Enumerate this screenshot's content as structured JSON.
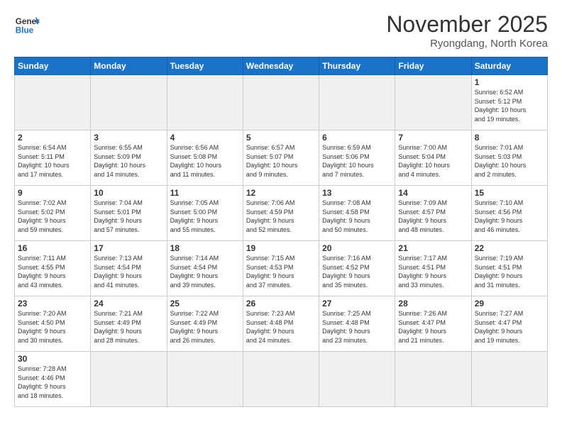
{
  "header": {
    "logo_general": "General",
    "logo_blue": "Blue",
    "month_title": "November 2025",
    "subtitle": "Ryongdang, North Korea"
  },
  "weekdays": [
    "Sunday",
    "Monday",
    "Tuesday",
    "Wednesday",
    "Thursday",
    "Friday",
    "Saturday"
  ],
  "weeks": [
    [
      {
        "day": "",
        "info": "",
        "empty": true
      },
      {
        "day": "",
        "info": "",
        "empty": true
      },
      {
        "day": "",
        "info": "",
        "empty": true
      },
      {
        "day": "",
        "info": "",
        "empty": true
      },
      {
        "day": "",
        "info": "",
        "empty": true
      },
      {
        "day": "",
        "info": "",
        "empty": true
      },
      {
        "day": "1",
        "info": "Sunrise: 6:52 AM\nSunset: 5:12 PM\nDaylight: 10 hours\nand 19 minutes."
      }
    ],
    [
      {
        "day": "2",
        "info": "Sunrise: 6:54 AM\nSunset: 5:11 PM\nDaylight: 10 hours\nand 17 minutes."
      },
      {
        "day": "3",
        "info": "Sunrise: 6:55 AM\nSunset: 5:09 PM\nDaylight: 10 hours\nand 14 minutes."
      },
      {
        "day": "4",
        "info": "Sunrise: 6:56 AM\nSunset: 5:08 PM\nDaylight: 10 hours\nand 11 minutes."
      },
      {
        "day": "5",
        "info": "Sunrise: 6:57 AM\nSunset: 5:07 PM\nDaylight: 10 hours\nand 9 minutes."
      },
      {
        "day": "6",
        "info": "Sunrise: 6:59 AM\nSunset: 5:06 PM\nDaylight: 10 hours\nand 7 minutes."
      },
      {
        "day": "7",
        "info": "Sunrise: 7:00 AM\nSunset: 5:04 PM\nDaylight: 10 hours\nand 4 minutes."
      },
      {
        "day": "8",
        "info": "Sunrise: 7:01 AM\nSunset: 5:03 PM\nDaylight: 10 hours\nand 2 minutes."
      }
    ],
    [
      {
        "day": "9",
        "info": "Sunrise: 7:02 AM\nSunset: 5:02 PM\nDaylight: 9 hours\nand 59 minutes."
      },
      {
        "day": "10",
        "info": "Sunrise: 7:04 AM\nSunset: 5:01 PM\nDaylight: 9 hours\nand 57 minutes."
      },
      {
        "day": "11",
        "info": "Sunrise: 7:05 AM\nSunset: 5:00 PM\nDaylight: 9 hours\nand 55 minutes."
      },
      {
        "day": "12",
        "info": "Sunrise: 7:06 AM\nSunset: 4:59 PM\nDaylight: 9 hours\nand 52 minutes."
      },
      {
        "day": "13",
        "info": "Sunrise: 7:08 AM\nSunset: 4:58 PM\nDaylight: 9 hours\nand 50 minutes."
      },
      {
        "day": "14",
        "info": "Sunrise: 7:09 AM\nSunset: 4:57 PM\nDaylight: 9 hours\nand 48 minutes."
      },
      {
        "day": "15",
        "info": "Sunrise: 7:10 AM\nSunset: 4:56 PM\nDaylight: 9 hours\nand 46 minutes."
      }
    ],
    [
      {
        "day": "16",
        "info": "Sunrise: 7:11 AM\nSunset: 4:55 PM\nDaylight: 9 hours\nand 43 minutes."
      },
      {
        "day": "17",
        "info": "Sunrise: 7:13 AM\nSunset: 4:54 PM\nDaylight: 9 hours\nand 41 minutes."
      },
      {
        "day": "18",
        "info": "Sunrise: 7:14 AM\nSunset: 4:54 PM\nDaylight: 9 hours\nand 39 minutes."
      },
      {
        "day": "19",
        "info": "Sunrise: 7:15 AM\nSunset: 4:53 PM\nDaylight: 9 hours\nand 37 minutes."
      },
      {
        "day": "20",
        "info": "Sunrise: 7:16 AM\nSunset: 4:52 PM\nDaylight: 9 hours\nand 35 minutes."
      },
      {
        "day": "21",
        "info": "Sunrise: 7:17 AM\nSunset: 4:51 PM\nDaylight: 9 hours\nand 33 minutes."
      },
      {
        "day": "22",
        "info": "Sunrise: 7:19 AM\nSunset: 4:51 PM\nDaylight: 9 hours\nand 31 minutes."
      }
    ],
    [
      {
        "day": "23",
        "info": "Sunrise: 7:20 AM\nSunset: 4:50 PM\nDaylight: 9 hours\nand 30 minutes."
      },
      {
        "day": "24",
        "info": "Sunrise: 7:21 AM\nSunset: 4:49 PM\nDaylight: 9 hours\nand 28 minutes."
      },
      {
        "day": "25",
        "info": "Sunrise: 7:22 AM\nSunset: 4:49 PM\nDaylight: 9 hours\nand 26 minutes."
      },
      {
        "day": "26",
        "info": "Sunrise: 7:23 AM\nSunset: 4:48 PM\nDaylight: 9 hours\nand 24 minutes."
      },
      {
        "day": "27",
        "info": "Sunrise: 7:25 AM\nSunset: 4:48 PM\nDaylight: 9 hours\nand 23 minutes."
      },
      {
        "day": "28",
        "info": "Sunrise: 7:26 AM\nSunset: 4:47 PM\nDaylight: 9 hours\nand 21 minutes."
      },
      {
        "day": "29",
        "info": "Sunrise: 7:27 AM\nSunset: 4:47 PM\nDaylight: 9 hours\nand 19 minutes."
      }
    ],
    [
      {
        "day": "30",
        "info": "Sunrise: 7:28 AM\nSunset: 4:46 PM\nDaylight: 9 hours\nand 18 minutes."
      },
      {
        "day": "",
        "info": "",
        "empty": true
      },
      {
        "day": "",
        "info": "",
        "empty": true
      },
      {
        "day": "",
        "info": "",
        "empty": true
      },
      {
        "day": "",
        "info": "",
        "empty": true
      },
      {
        "day": "",
        "info": "",
        "empty": true
      },
      {
        "day": "",
        "info": "",
        "empty": true
      }
    ]
  ]
}
